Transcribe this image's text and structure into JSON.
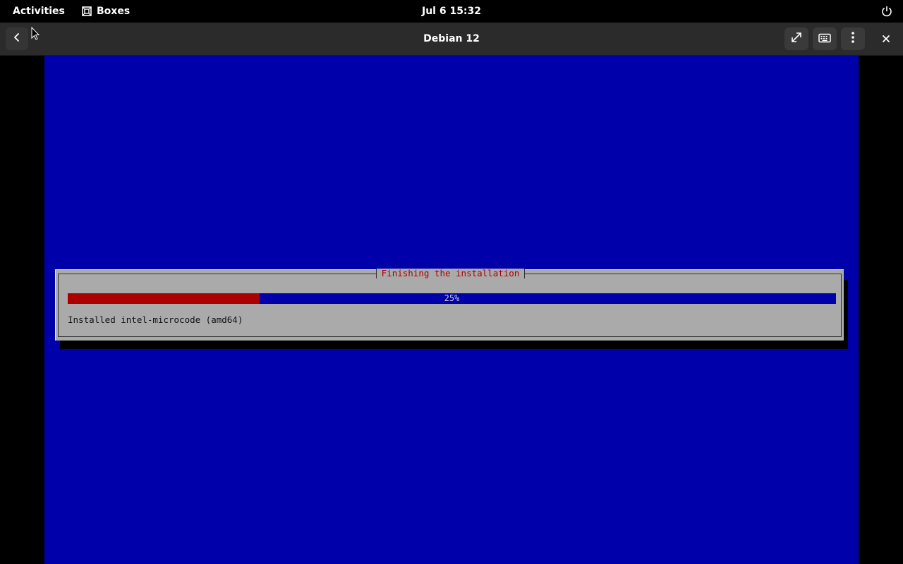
{
  "topbar": {
    "activities_label": "Activities",
    "app_name": "Boxes",
    "app_icon": "boxes-app-icon",
    "clock": "Jul 6  15:32",
    "power_icon": "power-icon"
  },
  "headerbar": {
    "title": "Debian 12",
    "back_icon": "chevron-left-icon",
    "buttons": [
      {
        "icon": "fullscreen-icon"
      },
      {
        "icon": "keyboard-icon"
      },
      {
        "icon": "kebab-menu-icon"
      },
      {
        "icon": "close-icon"
      }
    ]
  },
  "installer": {
    "dialog_title": "Finishing the installation",
    "progress_percent": 25,
    "progress_label": "25%",
    "status": "Installed intel-microcode (amd64)"
  },
  "colors": {
    "screen_background": "#0000aa",
    "dialog_background": "#aaaaaa",
    "progress_fill": "#aa0000",
    "title_text": "#aa0000"
  }
}
